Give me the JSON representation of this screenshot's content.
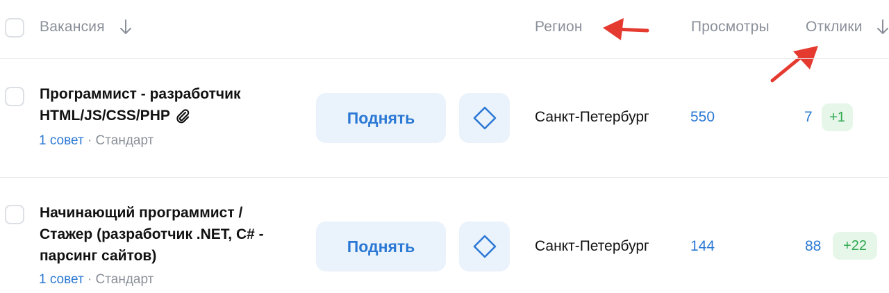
{
  "header": {
    "vacancy_label": "Вакансия",
    "region_label": "Регион",
    "views_label": "Просмотры",
    "responses_label": "Отклики"
  },
  "rows": [
    {
      "title_line1": "Программист - разработчик",
      "title_line2": "HTML/JS/CSS/PHP",
      "title_line3": "",
      "advice": "1 совет",
      "separator": "·",
      "plan": "Стандарт",
      "raise_label": "Поднять",
      "region": "Санкт-Петербург",
      "views": "550",
      "responses": "7",
      "responses_new": "+1"
    },
    {
      "title_line1": "Начинающий программист /",
      "title_line2": "Стажер (разработчик .NET, C# -",
      "title_line3": "парсинг сайтов)",
      "advice": "1 совет",
      "separator": "·",
      "plan": "Стандарт",
      "raise_label": "Поднять",
      "region": "Санкт-Петербург",
      "views": "144",
      "responses": "88",
      "responses_new": "+22"
    }
  ],
  "icons": {
    "sort_down": "arrow-down-icon",
    "attachment": "paperclip-icon",
    "premium": "diamond-icon",
    "annotation": "red-arrow-annotation"
  },
  "colors": {
    "accent": "#2b78d4",
    "button_bg": "#eaf3fc",
    "badge_bg": "#e6f7e9",
    "badge_text": "#2fa84f",
    "muted": "#8a9099",
    "annotation": "#e53a2f"
  }
}
